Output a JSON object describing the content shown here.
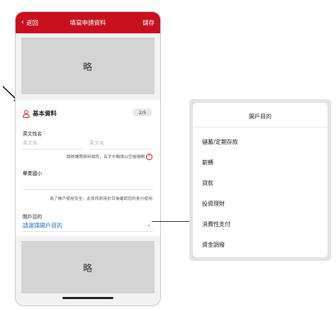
{
  "nav": {
    "back_label": "返回",
    "title": "填寫申請資料",
    "save_label": "儲存"
  },
  "placeholders": {
    "top_label": "略",
    "bottom_label": "略"
  },
  "section": {
    "title": "基本資料",
    "step": "2/5"
  },
  "fields": {
    "english_name_label": "英文姓名",
    "last_name_placeholder": "英文姓",
    "first_name_placeholder": "英文名",
    "name_hint": "請與護照資料相符，名字中間請以空格隔開",
    "school_label": "畢業國小",
    "school_hint": "為了帳戶使用安全，此資訊將用於日後確認您的身分使用",
    "purpose_label": "開戶目的",
    "purpose_value": "請選擇開戶目的"
  },
  "popup": {
    "title": "開戶目的",
    "options": [
      "儲蓄/定期存款",
      "薪轉",
      "貸款",
      "投資理財",
      "消費性支付",
      "資金調撥"
    ]
  },
  "colors": {
    "brand_red": "#c8101e",
    "link_blue": "#2a6fb7"
  }
}
